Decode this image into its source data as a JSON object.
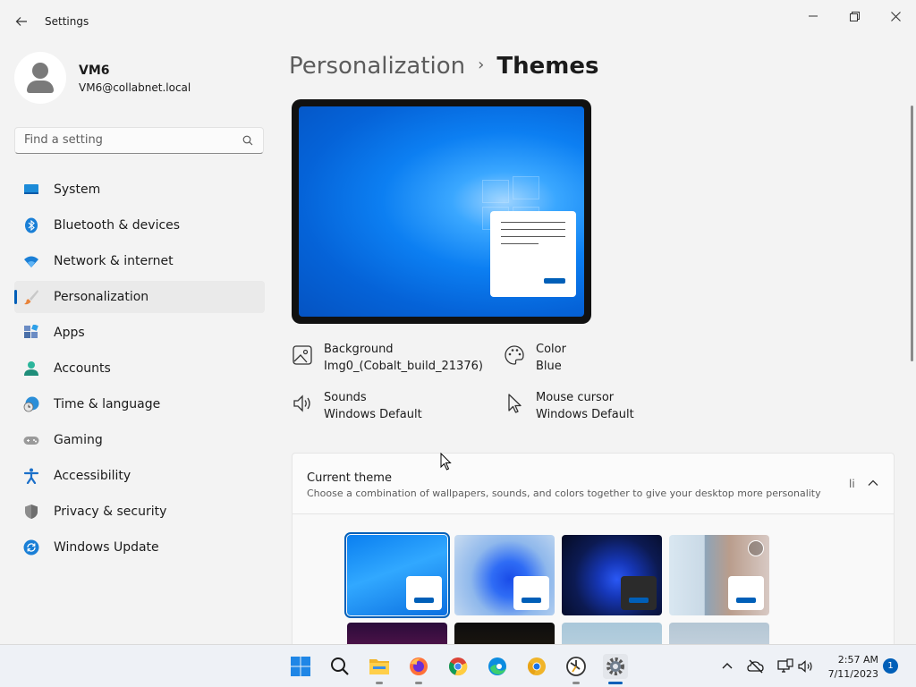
{
  "window": {
    "title": "Settings",
    "back_icon": "back-arrow-icon",
    "minimize_icon": "minimize-icon",
    "maximize_icon": "restore-icon",
    "close_icon": "close-icon"
  },
  "profile": {
    "name": "VM6",
    "email": "VM6@collabnet.local"
  },
  "search": {
    "placeholder": "Find a setting",
    "value": ""
  },
  "nav": {
    "items": [
      {
        "label": "System",
        "icon": "system-icon"
      },
      {
        "label": "Bluetooth & devices",
        "icon": "bluetooth-icon"
      },
      {
        "label": "Network & internet",
        "icon": "wifi-icon"
      },
      {
        "label": "Personalization",
        "icon": "brush-icon",
        "selected": true
      },
      {
        "label": "Apps",
        "icon": "apps-icon"
      },
      {
        "label": "Accounts",
        "icon": "accounts-icon"
      },
      {
        "label": "Time & language",
        "icon": "time-language-icon"
      },
      {
        "label": "Gaming",
        "icon": "gamepad-icon"
      },
      {
        "label": "Accessibility",
        "icon": "accessibility-icon"
      },
      {
        "label": "Privacy & security",
        "icon": "shield-icon"
      },
      {
        "label": "Windows Update",
        "icon": "update-icon"
      }
    ]
  },
  "breadcrumb": {
    "parent": "Personalization",
    "separator": "›",
    "current": "Themes"
  },
  "properties": {
    "background": {
      "title": "Background",
      "value": "Img0_(Cobalt_build_21376)"
    },
    "color": {
      "title": "Color",
      "value": "Blue"
    },
    "sounds": {
      "title": "Sounds",
      "value": "Windows Default"
    },
    "mouse_cursor": {
      "title": "Mouse cursor",
      "value": "Windows Default"
    }
  },
  "current_theme": {
    "title": "Current theme",
    "description": "Choose a combination of wallpapers, sounds, and colors together to give your desktop more personality",
    "trailing_text": "li"
  },
  "taskbar": {
    "apps": [
      "start-icon",
      "search-icon",
      "file-explorer-icon",
      "firefox-icon",
      "chrome-icon",
      "edge-icon",
      "chrome-canary-icon",
      "clock-app-icon",
      "settings-icon"
    ],
    "clock": {
      "time": "2:57 AM",
      "date": "7/11/2023"
    },
    "notification_count": "1"
  },
  "colors": {
    "accent": "#005fb8",
    "background": "#f3f3f3"
  }
}
